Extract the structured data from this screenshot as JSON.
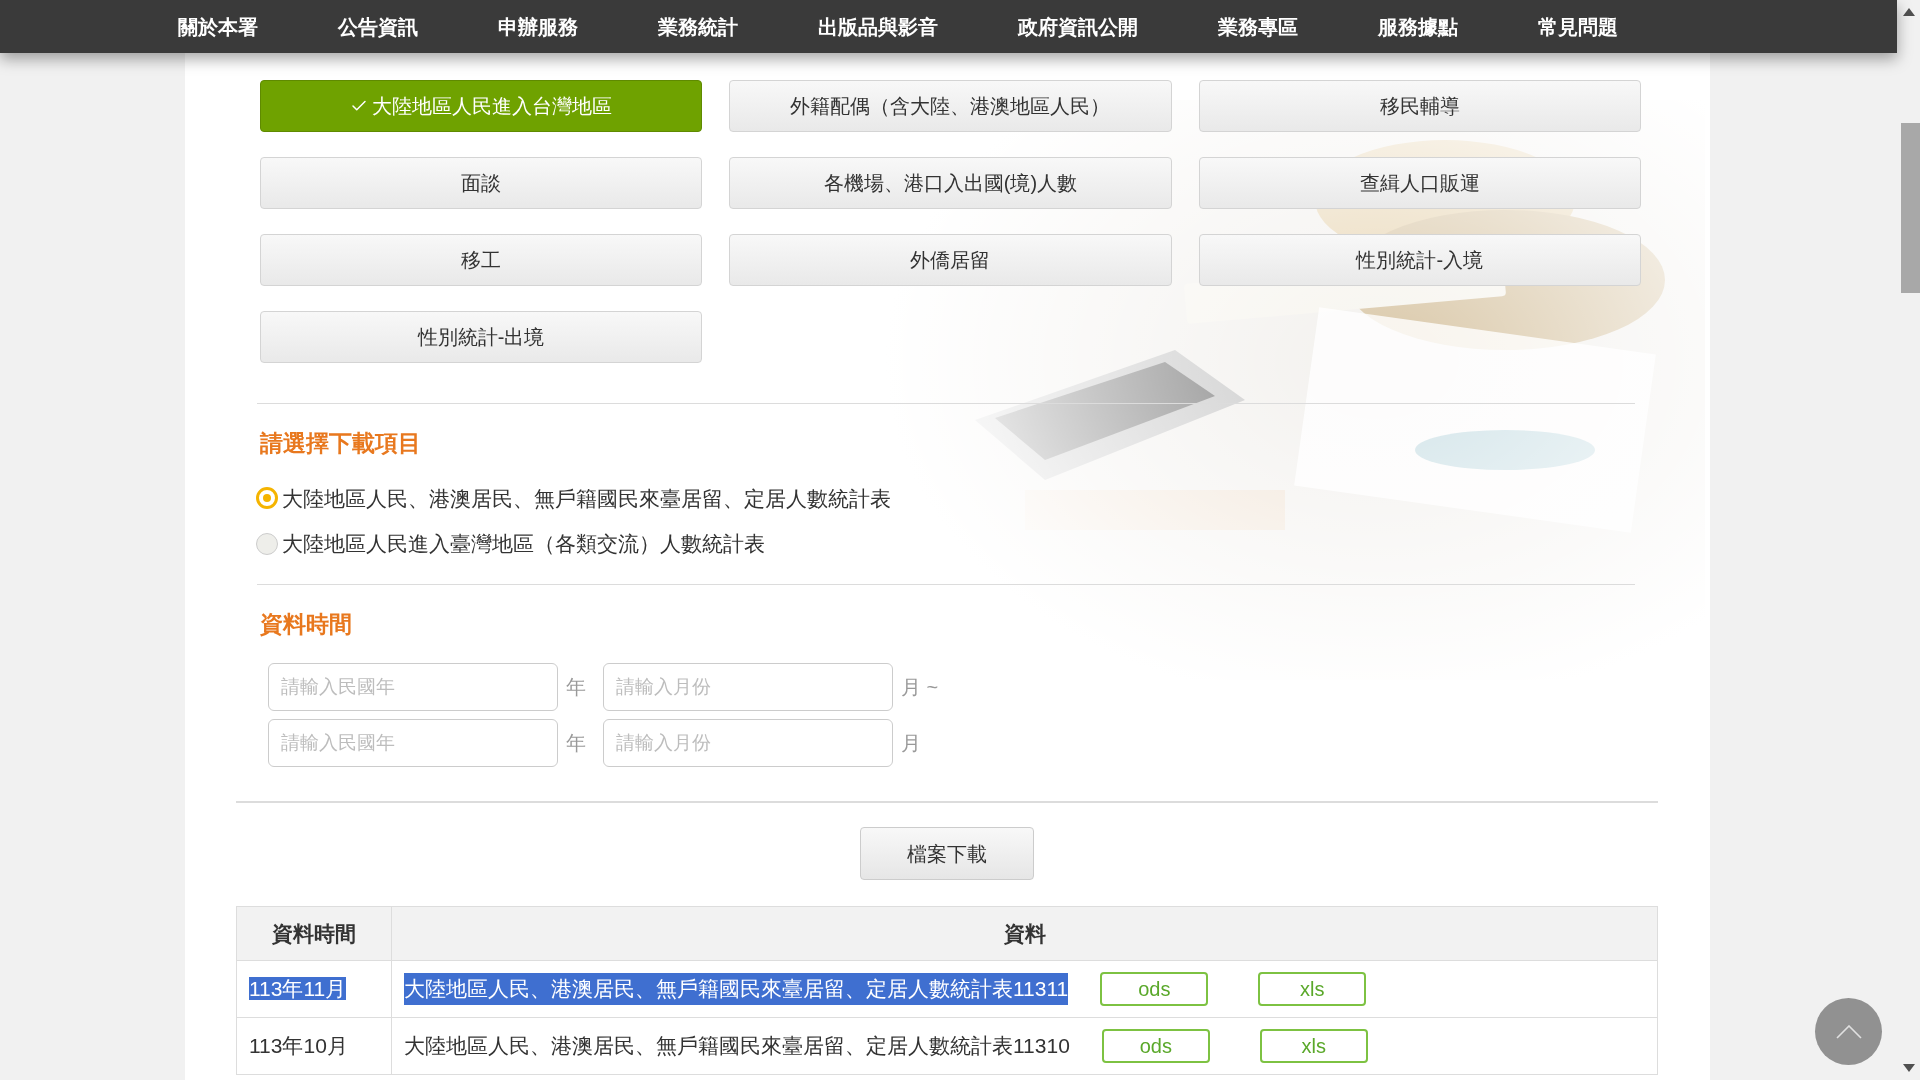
{
  "nav": [
    "關於本署",
    "公告資訊",
    "申辦服務",
    "業務統計",
    "出版品與影音",
    "政府資訊公開",
    "業務專區",
    "服務據點",
    "常見問題"
  ],
  "categories": [
    {
      "label": "大陸地區人民進入台灣地區",
      "selected": true
    },
    {
      "label": "外籍配偶（含大陸、港澳地區人民）",
      "selected": false
    },
    {
      "label": "移民輔導",
      "selected": false
    },
    {
      "label": "面談",
      "selected": false
    },
    {
      "label": "各機場、港口入出國(境)人數",
      "selected": false
    },
    {
      "label": "查緝人口販運",
      "selected": false
    },
    {
      "label": "移工",
      "selected": false
    },
    {
      "label": "外僑居留",
      "selected": false
    },
    {
      "label": "性別統計-入境",
      "selected": false
    },
    {
      "label": "性別統計-出境",
      "selected": false
    }
  ],
  "download_items": {
    "heading": "請選擇下載項目",
    "options": [
      {
        "label": "大陸地區人民、港澳居民、無戶籍國民來臺居留、定居人數統計表",
        "selected": true
      },
      {
        "label": "大陸地區人民進入臺灣地區（各類交流）人數統計表",
        "selected": false
      }
    ]
  },
  "data_time": {
    "heading": "資料時間",
    "rows": [
      {
        "year_placeholder": "請輸入民國年",
        "year_unit": "年",
        "month_placeholder": "請輸入月份",
        "month_unit": "月 ~"
      },
      {
        "year_placeholder": "請輸入民國年",
        "year_unit": "年",
        "month_placeholder": "請輸入月份",
        "month_unit": "月"
      }
    ]
  },
  "download_button": "檔案下載",
  "table": {
    "columns": [
      "資料時間",
      "資料"
    ],
    "rows": [
      {
        "time": "113年11月",
        "title": "大陸地區人民、港澳居民、無戶籍國民來臺居留、定居人數統計表11311",
        "files": [
          "ods",
          "xls"
        ],
        "highlighted": true
      },
      {
        "time": "113年10月",
        "title": "大陸地區人民、港澳居民、無戶籍國民來臺居留、定居人數統計表11310",
        "files": [
          "ods",
          "xls"
        ],
        "highlighted": false
      }
    ]
  }
}
